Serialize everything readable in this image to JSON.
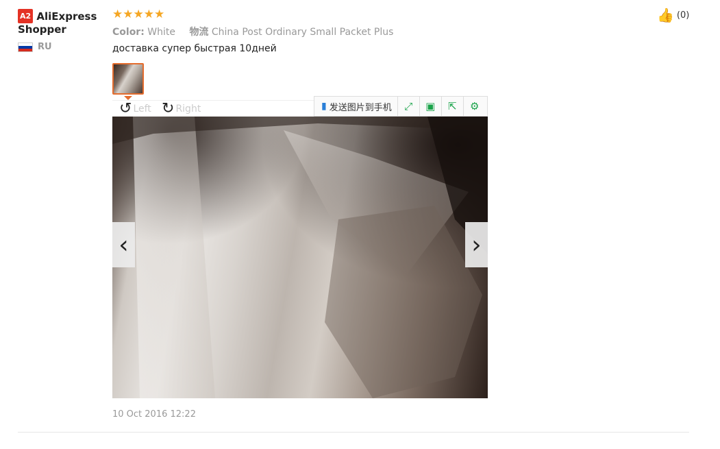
{
  "user": {
    "badge": "A2",
    "name": "AliExpress Shopper",
    "country_code": "RU",
    "flag_colors": [
      "#ffffff",
      "#0039a6",
      "#d52b1e"
    ]
  },
  "review": {
    "rating": 5,
    "color_label": "Color:",
    "color_value": "White",
    "logistics_label": "物流",
    "logistics_value": "China Post Ordinary Small Packet Plus",
    "text": "доставка супер быстрая 10дней",
    "date": "10 Oct 2016 12:22"
  },
  "viewer": {
    "rotate_left": "Left",
    "rotate_right": "Right",
    "send_to_phone": "发送图片到手机",
    "toolbar_icons": [
      "expand-icon",
      "save-icon",
      "share-icon",
      "settings-icon"
    ]
  },
  "helpful": {
    "count": "(0)"
  },
  "colors": {
    "accent": "#e46c2d",
    "star": "#f5a623",
    "badge": "#e43225",
    "tool_green": "#1aa34a"
  }
}
